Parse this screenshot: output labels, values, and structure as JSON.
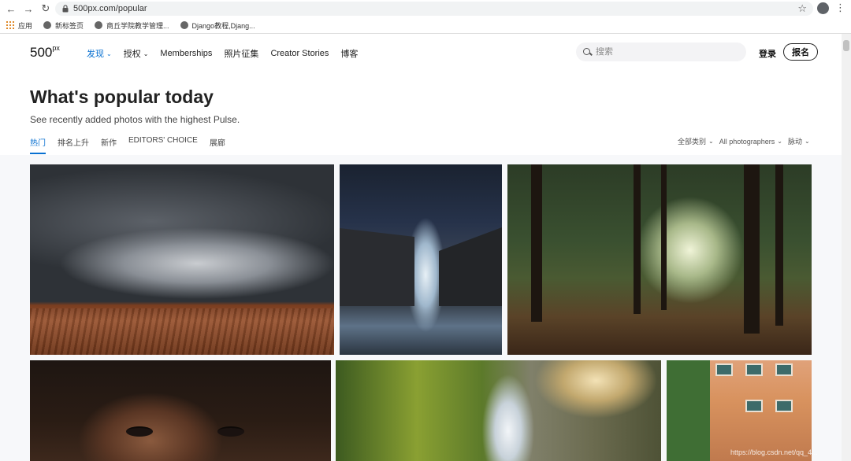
{
  "browser": {
    "url": "500px.com/popular",
    "bookmarks": [
      {
        "label": "应用",
        "icon": "apps-icon"
      },
      {
        "label": "新标签页",
        "icon": "globe-icon"
      },
      {
        "label": "商丘学院教学管理...",
        "icon": "globe-icon"
      },
      {
        "label": "Django教程,Djang...",
        "icon": "globe-icon"
      }
    ]
  },
  "header": {
    "logo": "500",
    "logo_sup": "px",
    "nav": [
      {
        "label": "发现",
        "has_dropdown": true,
        "active": true
      },
      {
        "label": "授权",
        "has_dropdown": true,
        "active": false
      },
      {
        "label": "Memberships",
        "has_dropdown": false,
        "active": false
      },
      {
        "label": "照片征集",
        "has_dropdown": false,
        "active": false
      },
      {
        "label": "Creator Stories",
        "has_dropdown": false,
        "active": false
      },
      {
        "label": "博客",
        "has_dropdown": false,
        "active": false
      }
    ],
    "search_placeholder": "搜索",
    "login_label": "登录",
    "signup_label": "报名"
  },
  "hero": {
    "title": "What's popular today",
    "subtitle": "See recently added photos with the highest Pulse."
  },
  "tabs": [
    "热门",
    "排名上升",
    "新作",
    "EDITORS' CHOICE",
    "展廊"
  ],
  "active_tab": "热门",
  "filters": [
    "全部类别",
    "All photographers",
    "脉动"
  ],
  "photos": [
    {
      "subject": "storm supercell over plowed field"
    },
    {
      "subject": "waterfall under milky way"
    },
    {
      "subject": "sunlit forest with trees"
    },
    {
      "subject": "close-up portrait eyes"
    },
    {
      "subject": "waterfall in green valley"
    },
    {
      "subject": "colorful building street portrait"
    }
  ],
  "watermark": "https://blog.csdn.net/qq_4...",
  "colors": {
    "accent": "#0870d1",
    "text": "#222222"
  }
}
